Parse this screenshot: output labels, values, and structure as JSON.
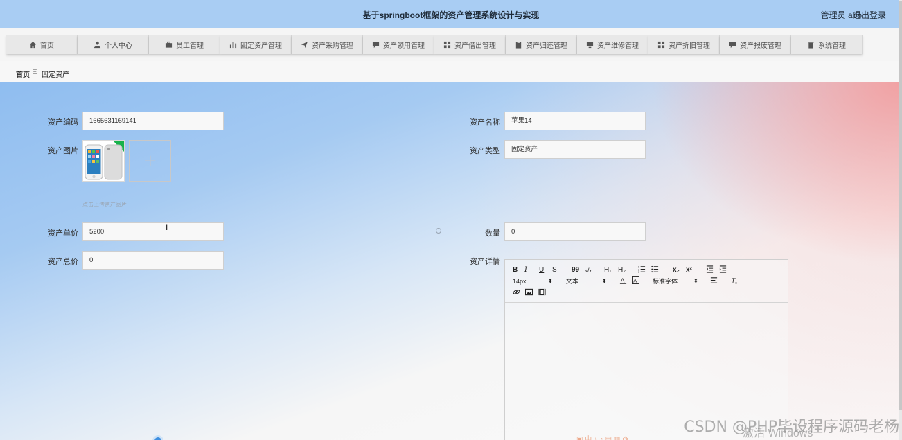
{
  "header": {
    "title": "基于springboot框架的资产管理系统设计与实现",
    "user": "管理员 abo",
    "logout": "退出登录"
  },
  "nav": [
    {
      "label": "首页",
      "icon": "home-icon"
    },
    {
      "label": "个人中心",
      "icon": "user-icon"
    },
    {
      "label": "员工管理",
      "icon": "briefcase-icon"
    },
    {
      "label": "固定资产管理",
      "icon": "bar-chart-icon"
    },
    {
      "label": "资产采购管理",
      "icon": "send-icon"
    },
    {
      "label": "资产领用管理",
      "icon": "comment-icon"
    },
    {
      "label": "资产借出管理",
      "icon": "grid-icon"
    },
    {
      "label": "资产归还管理",
      "icon": "clipboard-icon"
    },
    {
      "label": "资产维修管理",
      "icon": "monitor-icon"
    },
    {
      "label": "资产折旧管理",
      "icon": "grid-icon"
    },
    {
      "label": "资产报废管理",
      "icon": "comment-icon"
    },
    {
      "label": "系统管理",
      "icon": "trash-icon"
    }
  ],
  "breadcrumb": {
    "home": "首页",
    "separator": "Ξ",
    "current": "固定资产"
  },
  "form": {
    "code_label": "资产编码",
    "code_value": "1665631169141",
    "name_label": "资产名称",
    "name_value": "苹果14",
    "image_label": "资产图片",
    "type_label": "资产类型",
    "type_value": "固定资产",
    "upload_hint": "点击上传资产图片",
    "price_label": "资产单价",
    "price_value": "5200",
    "qty_label": "数量",
    "qty_value": "0",
    "total_label": "资产总价",
    "total_value": "0",
    "detail_label": "资产详情"
  },
  "editor": {
    "bold": "B",
    "italic": "I",
    "underline": "U",
    "strike": "S",
    "quote": "99",
    "code": "‹/›",
    "h1": "H₁",
    "h2": "H₂",
    "sub": "x₂",
    "sup": "x²",
    "font_size": "14px",
    "block": "文本",
    "font_family": "标准字体",
    "arrow": "⬍"
  },
  "watermark": {
    "text": "CSDN @PHP毕设程序源码老杨",
    "activate": "激活 Windows"
  }
}
